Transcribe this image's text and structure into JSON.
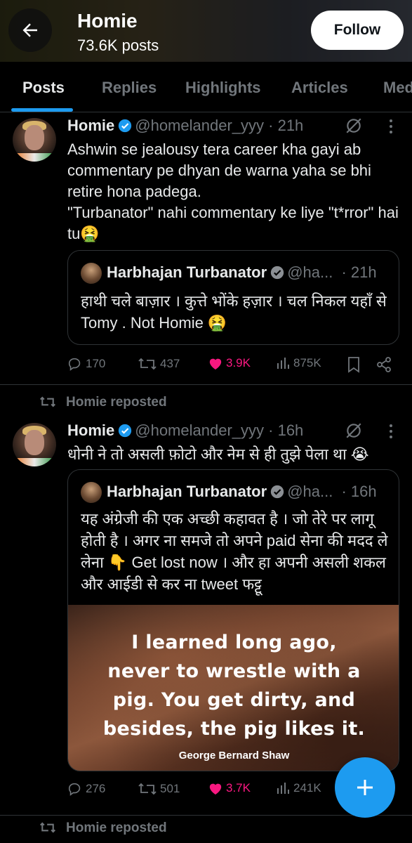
{
  "header": {
    "title": "Homie",
    "subtitle": "73.6K posts",
    "follow_label": "Follow"
  },
  "tabs": [
    {
      "label": "Posts",
      "active": true
    },
    {
      "label": "Replies"
    },
    {
      "label": "Highlights"
    },
    {
      "label": "Articles"
    },
    {
      "label": "Media"
    }
  ],
  "posts": [
    {
      "name": "Homie",
      "handle": "@homelander_yyy",
      "time": "· 21h",
      "text": "Ashwin se jealousy tera career kha gayi ab commentary pe dhyan de warna yaha se bhi retire hona padega.",
      "text2": "\"Turbanator\" nahi commentary ke liye \"t*rror\" hai tu🤮",
      "quote": {
        "name": "Harbhajan Turbanator",
        "handle": "@ha...",
        "time": "· 21h",
        "text": "हाथी चले बाज़ार । कुत्ते भोंके हज़ार । चल निकल यहाँ से Tomy . Not Homie 🤮"
      },
      "stats": {
        "replies": "170",
        "reposts": "437",
        "likes": "3.9K",
        "views": "875K"
      }
    },
    {
      "reposted_label": "Homie reposted",
      "name": "Homie",
      "handle": "@homelander_yyy",
      "time": "· 16h",
      "text": "धोनी ने तो असली फ़ोटो और नेम से ही तुझे पेला था 😭",
      "quote": {
        "name": "Harbhajan Turbanator",
        "handle": "@ha...",
        "time": "· 16h",
        "text": "यह अंग्रेजी की एक अच्छी कहावत है । जो तेरे पर लागू होती है । अगर ना समजे तो अपने paid सेना की मदद ले लेना 👇 Get lost now । और हा अपनी असली शकल और आईडी से कर ना tweet फट्टू",
        "image_lines": [
          "I learned long ago,",
          "never to wrestle with a",
          "pig. You get dirty, and",
          "besides, the pig likes it."
        ],
        "image_author": "George Bernard Shaw"
      },
      "stats": {
        "replies": "276",
        "reposts": "501",
        "likes": "3.7K",
        "views": "241K"
      }
    }
  ],
  "footer_repost_label": "Homie reposted",
  "colors": {
    "accent": "#1d9bf0",
    "like": "#f91880",
    "muted": "#71767b",
    "divider": "#2f3336"
  },
  "icons": [
    "back-arrow-icon",
    "verified-badge-icon",
    "grok-icon",
    "more-vertical-icon",
    "reply-icon",
    "repost-icon",
    "like-icon",
    "views-icon",
    "bookmark-icon",
    "share-icon",
    "compose-plus-icon"
  ]
}
